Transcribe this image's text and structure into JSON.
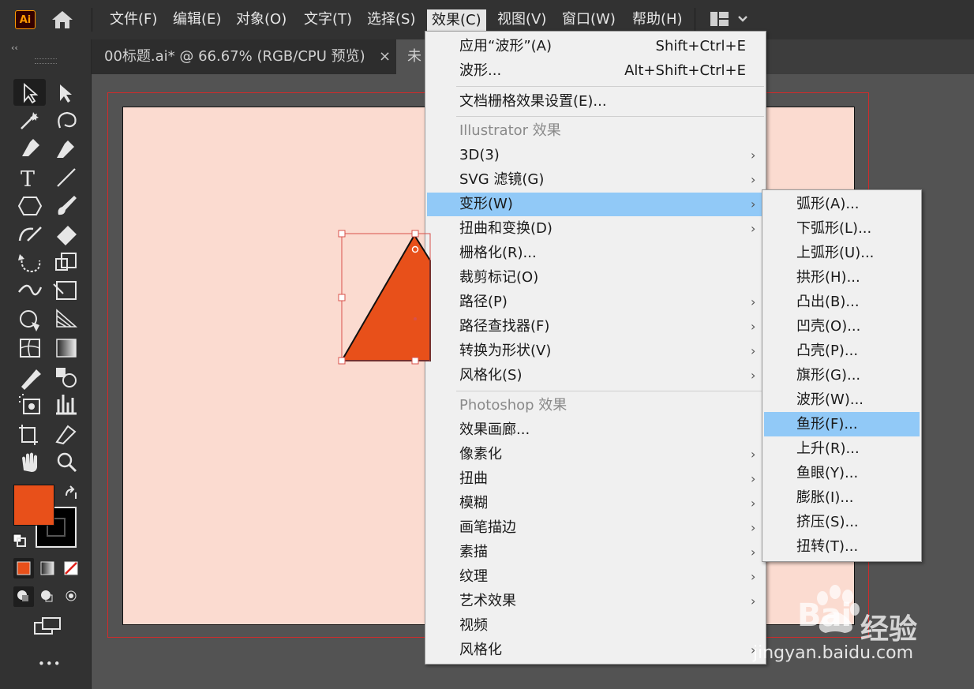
{
  "app": {
    "logo": "Ai",
    "home_icon": "home-icon"
  },
  "menubar": {
    "items": [
      "文件(F)",
      "编辑(E)",
      "对象(O)",
      "文字(T)",
      "选择(S)",
      "效果(C)",
      "视图(V)",
      "窗口(W)",
      "帮助(H)"
    ],
    "active": "效果(C)"
  },
  "tabs": [
    {
      "title": "00标题.ai* @ 66.67% (RGB/CPU 预览)",
      "close": "×"
    },
    {
      "title": "未"
    }
  ],
  "colors": {
    "fill": "#e8501a",
    "stroke": "#000000",
    "artboard_bg": "#fbdbd0",
    "menu_highlight": "#91c9f7",
    "bleed": "#d12b2b"
  },
  "effect_menu": {
    "items": [
      {
        "label": "应用“波形”(A)",
        "shortcut": "Shift+Ctrl+E"
      },
      {
        "label": "波形...",
        "shortcut": "Alt+Shift+Ctrl+E"
      },
      {
        "label": "文档栅格效果设置(E)..."
      },
      {
        "label": "Illustrator 效果",
        "section": true
      },
      {
        "label": "3D(3)",
        "submenu": true
      },
      {
        "label": "SVG 滤镜(G)",
        "submenu": true
      },
      {
        "label": "变形(W)",
        "submenu": true,
        "highlighted": true
      },
      {
        "label": "扭曲和变换(D)",
        "submenu": true
      },
      {
        "label": "栅格化(R)..."
      },
      {
        "label": "裁剪标记(O)"
      },
      {
        "label": "路径(P)",
        "submenu": true
      },
      {
        "label": "路径查找器(F)",
        "submenu": true
      },
      {
        "label": "转换为形状(V)",
        "submenu": true
      },
      {
        "label": "风格化(S)",
        "submenu": true
      },
      {
        "label": "Photoshop 效果",
        "section": true
      },
      {
        "label": "效果画廊..."
      },
      {
        "label": "像素化",
        "submenu": true
      },
      {
        "label": "扭曲",
        "submenu": true
      },
      {
        "label": "模糊",
        "submenu": true
      },
      {
        "label": "画笔描边",
        "submenu": true
      },
      {
        "label": "素描",
        "submenu": true
      },
      {
        "label": "纹理",
        "submenu": true
      },
      {
        "label": "艺术效果",
        "submenu": true
      },
      {
        "label": "视频"
      },
      {
        "label": "风格化",
        "submenu": true
      }
    ],
    "submenu_arrow": "›"
  },
  "warp_submenu": {
    "items": [
      "弧形(A)...",
      "下弧形(L)...",
      "上弧形(U)...",
      "拱形(H)...",
      "凸出(B)...",
      "凹壳(O)...",
      "凸壳(P)...",
      "旗形(G)...",
      "波形(W)...",
      "鱼形(F)...",
      "上升(R)...",
      "鱼眼(Y)...",
      "膨胀(I)...",
      "挤压(S)...",
      "扭转(T)..."
    ],
    "highlighted": "鱼形(F)..."
  },
  "toolbar": {
    "collapse": "‹‹",
    "tools": [
      "selection-tool",
      "direct-selection-tool",
      "magic-wand-tool",
      "lasso-tool",
      "pen-tool",
      "curvature-tool",
      "type-tool",
      "line-segment-tool",
      "polygon-tool",
      "paintbrush-tool",
      "shaper-tool",
      "eraser-tool",
      "rotate-tool",
      "scale-tool",
      "width-tool",
      "free-transform-tool",
      "shape-builder-tool",
      "perspective-grid-tool",
      "mesh-tool",
      "gradient-tool",
      "eyedropper-tool",
      "blend-tool",
      "symbol-sprayer-tool",
      "column-graph-tool",
      "artboard-tool",
      "slice-tool",
      "hand-tool",
      "zoom-tool"
    ],
    "more": "•••"
  },
  "watermark": {
    "brand": "Bai",
    "brand_cn": "经验",
    "url": "jingyan.baidu.com"
  }
}
